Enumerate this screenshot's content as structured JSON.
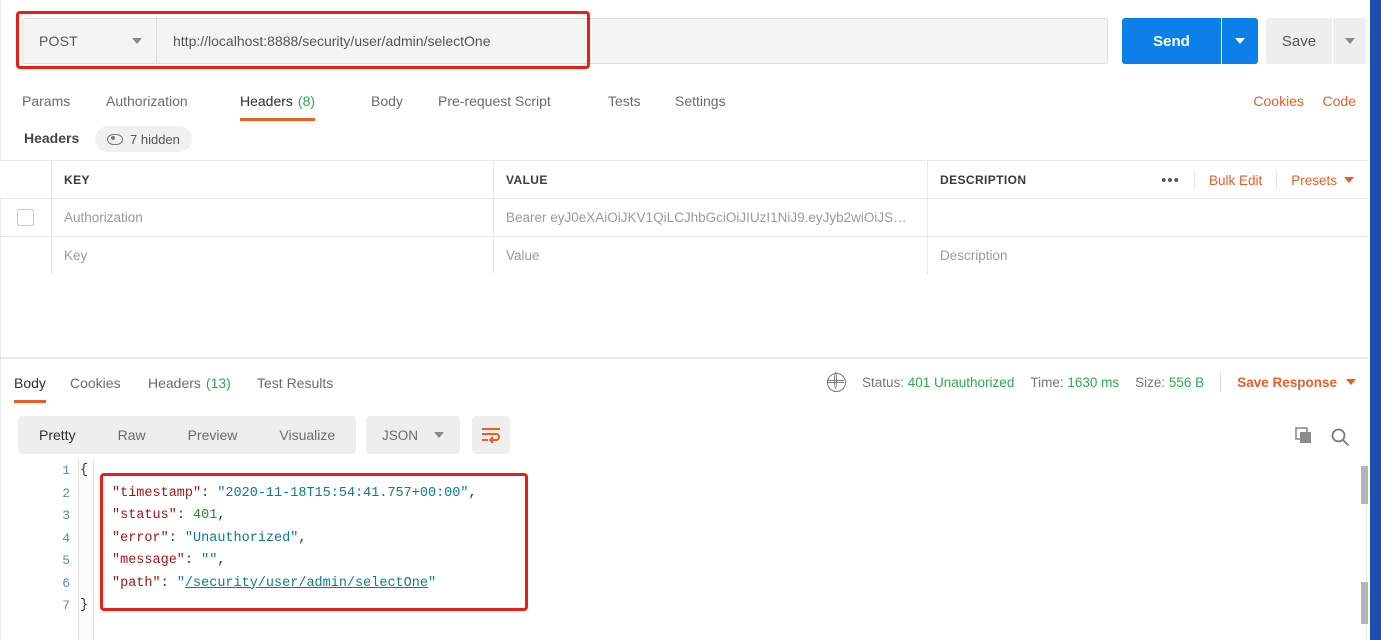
{
  "request": {
    "method": "POST",
    "url": "http://localhost:8888/security/user/admin/selectOne",
    "send_label": "Send",
    "save_label": "Save",
    "tabs": [
      {
        "label": "Params",
        "count": "",
        "active": false
      },
      {
        "label": "Authorization",
        "count": "",
        "active": false
      },
      {
        "label": "Headers",
        "count": "(8)",
        "active": true
      },
      {
        "label": "Body",
        "count": "",
        "active": false
      },
      {
        "label": "Pre-request Script",
        "count": "",
        "active": false
      },
      {
        "label": "Tests",
        "count": "",
        "active": false
      },
      {
        "label": "Settings",
        "count": "",
        "active": false
      }
    ],
    "cookies_link": "Cookies",
    "code_link": "Code"
  },
  "headers_panel": {
    "title": "Headers",
    "hidden_pill": "7 hidden",
    "columns": {
      "key": "KEY",
      "value": "VALUE",
      "description": "DESCRIPTION"
    },
    "actions": {
      "dots": "•••",
      "bulk_edit": "Bulk Edit",
      "presets": "Presets"
    },
    "rows": [
      {
        "key": "Authorization",
        "value": "Bearer eyJ0eXAiOiJKV1QiLCJhbGciOiJIUzI1NiJ9.eyJyb2wiOiJS…",
        "description": "",
        "checked": false,
        "is_placeholder": false
      },
      {
        "key": "Key",
        "value": "Value",
        "description": "Description",
        "checked": false,
        "is_placeholder": true
      }
    ]
  },
  "response": {
    "tabs": [
      {
        "label": "Body",
        "count": "",
        "active": true
      },
      {
        "label": "Cookies",
        "count": "",
        "active": false
      },
      {
        "label": "Headers",
        "count": "(13)",
        "active": false
      },
      {
        "label": "Test Results",
        "count": "",
        "active": false
      }
    ],
    "meta": {
      "status_label": "Status:",
      "status_value": "401 Unauthorized",
      "time_label": "Time:",
      "time_value": "1630 ms",
      "size_label": "Size:",
      "size_value": "556 B",
      "save_response": "Save Response"
    },
    "toolbar": {
      "view_modes": [
        {
          "label": "Pretty",
          "active": true
        },
        {
          "label": "Raw",
          "active": false
        },
        {
          "label": "Preview",
          "active": false
        },
        {
          "label": "Visualize",
          "active": false
        }
      ],
      "format": "JSON"
    },
    "body": {
      "line_numbers": [
        "1",
        "2",
        "3",
        "4",
        "5",
        "6",
        "7"
      ],
      "lines": [
        {
          "indent": 0,
          "tokens": [
            {
              "t": "punc",
              "v": "{"
            }
          ]
        },
        {
          "indent": 1,
          "tokens": [
            {
              "t": "key",
              "v": "\"timestamp\""
            },
            {
              "t": "punc",
              "v": ": "
            },
            {
              "t": "str",
              "v": "\"2020-11-18T15:54:41.757+00:00\""
            },
            {
              "t": "punc",
              "v": ","
            }
          ]
        },
        {
          "indent": 1,
          "tokens": [
            {
              "t": "key",
              "v": "\"status\""
            },
            {
              "t": "punc",
              "v": ": "
            },
            {
              "t": "num",
              "v": "401"
            },
            {
              "t": "punc",
              "v": ","
            }
          ]
        },
        {
          "indent": 1,
          "tokens": [
            {
              "t": "key",
              "v": "\"error\""
            },
            {
              "t": "punc",
              "v": ": "
            },
            {
              "t": "str",
              "v": "\"Unauthorized\""
            },
            {
              "t": "punc",
              "v": ","
            }
          ]
        },
        {
          "indent": 1,
          "tokens": [
            {
              "t": "key",
              "v": "\"message\""
            },
            {
              "t": "punc",
              "v": ": "
            },
            {
              "t": "str",
              "v": "\"\""
            },
            {
              "t": "punc",
              "v": ","
            }
          ]
        },
        {
          "indent": 1,
          "tokens": [
            {
              "t": "key",
              "v": "\"path\""
            },
            {
              "t": "punc",
              "v": ": "
            },
            {
              "t": "str",
              "v": "\""
            },
            {
              "t": "link",
              "v": "/security/user/admin/selectOne"
            },
            {
              "t": "str",
              "v": "\""
            }
          ]
        },
        {
          "indent": 0,
          "tokens": [
            {
              "t": "punc",
              "v": "}"
            }
          ]
        }
      ]
    }
  },
  "colors": {
    "accent_orange": "#ef5b25",
    "send_blue": "#0d7fe8",
    "status_green": "#2fa84f",
    "annotation_red": "#ee1c14",
    "window_blue": "#1f4eae"
  }
}
